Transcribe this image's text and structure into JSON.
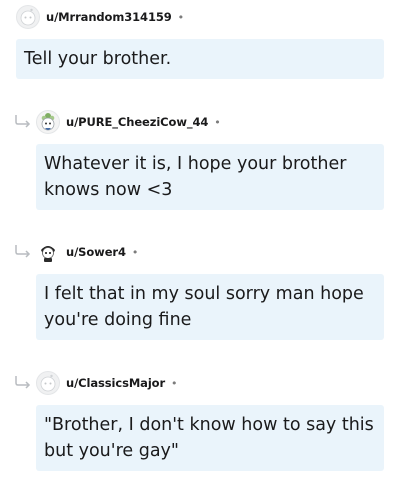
{
  "comments": [
    {
      "username": "u/Mrrandom314159",
      "separator": "•",
      "body": "Tell your brother.",
      "avatar_icon": "snoo-avatar-default-icon",
      "is_reply": false
    },
    {
      "username": "u/PURE_CheeziCow_44",
      "separator": "•",
      "body": "Whatever it is, I hope your brother knows now <3",
      "avatar_icon": "snoo-avatar-flower-icon",
      "is_reply": true
    },
    {
      "username": "u/Sower4",
      "separator": "•",
      "body": "I felt that in my soul sorry man hope you're doing fine",
      "avatar_icon": "snoo-avatar-dark-hair-icon",
      "is_reply": true
    },
    {
      "username": "u/ClassicsMajor",
      "separator": "•",
      "body": "\"Brother, I don't know how to say this but you're gay\"",
      "avatar_icon": "snoo-avatar-default-icon",
      "is_reply": true
    }
  ],
  "colors": {
    "bubble_background": "#eaf4fb",
    "text": "#1a1a1b",
    "meta_gray": "#7c7c7c"
  }
}
